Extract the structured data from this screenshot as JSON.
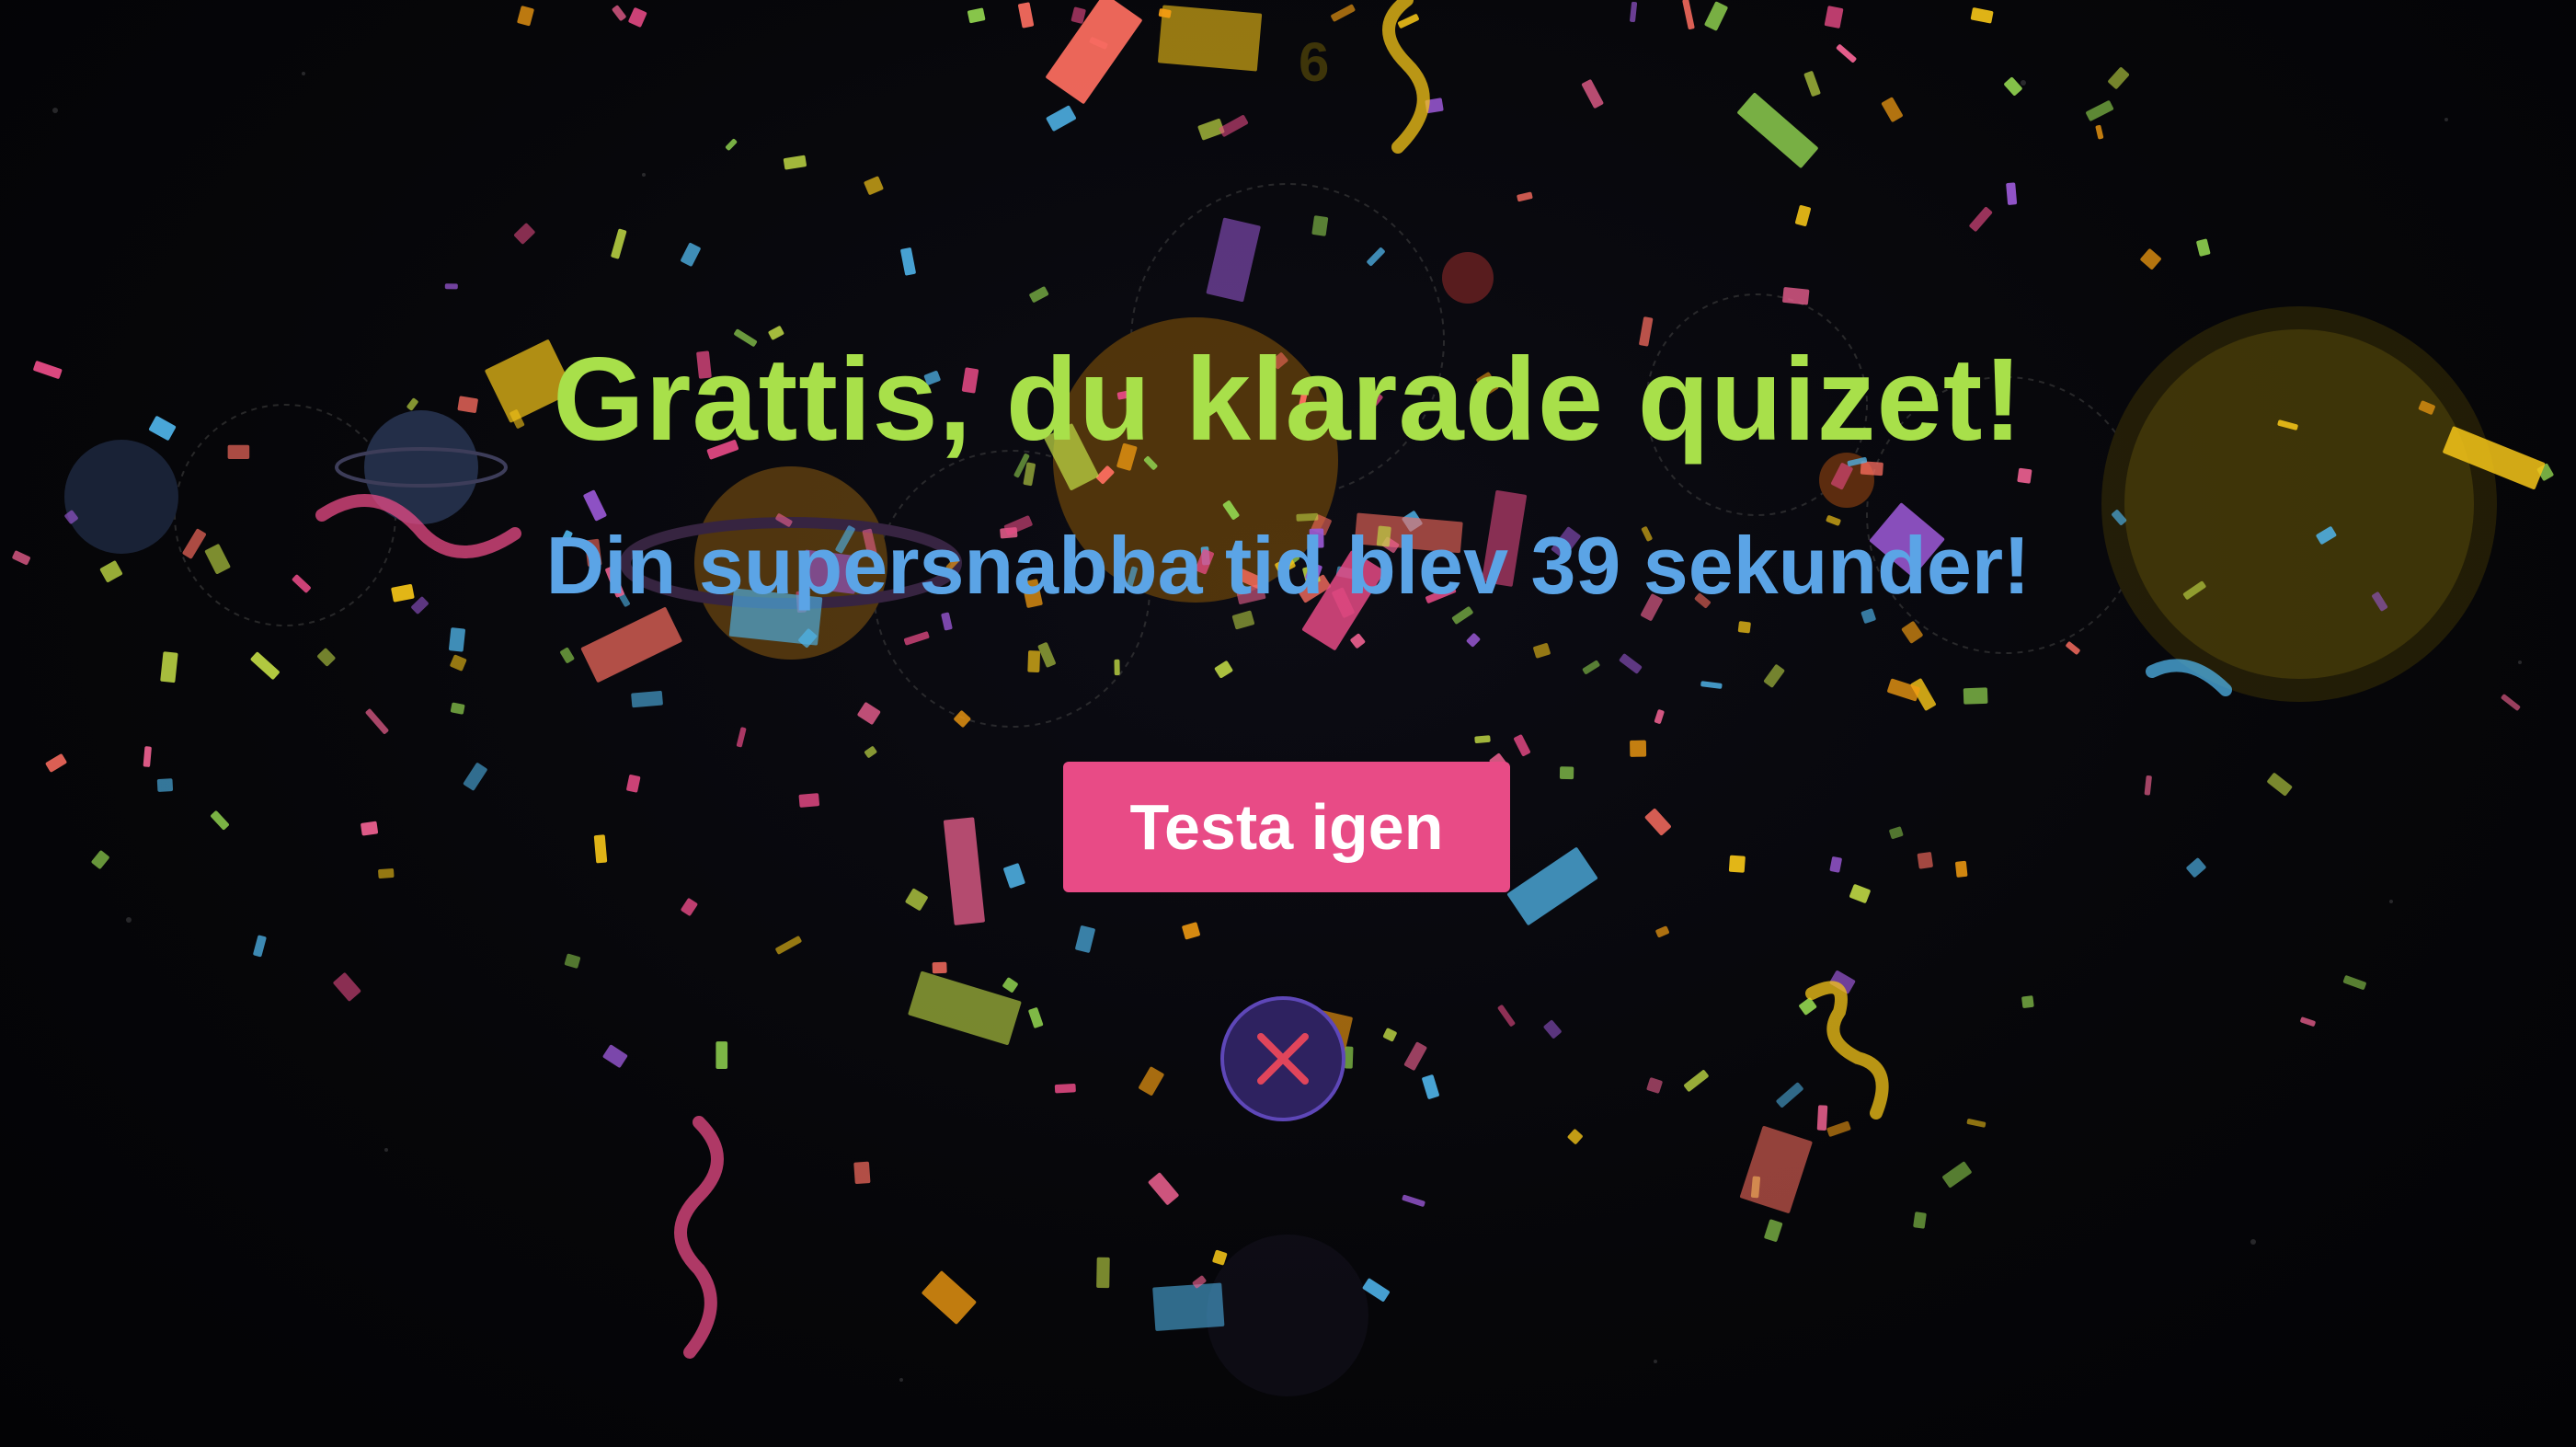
{
  "colors": {
    "background": "#050508",
    "headline": "#a8e04a",
    "subline": "#5ba4e6",
    "retry_button": "#e84b86",
    "close_button": "#2e2260",
    "close_cross": "#e0455b",
    "confetti": [
      "#e84b86",
      "#f5c518",
      "#8fd14f",
      "#4fb3e8",
      "#9b59d6",
      "#f39c12",
      "#ff6f61",
      "#f06292",
      "#c0d945"
    ]
  },
  "result": {
    "title": "Grattis, du klarade quizet!",
    "time_message": "Din supersnabba tid blev 39 sekunder!"
  },
  "actions": {
    "retry_label": "Testa igen",
    "close_icon": "close-icon"
  },
  "background": {
    "decor": "space-planets-dimmed",
    "effect": "confetti"
  }
}
